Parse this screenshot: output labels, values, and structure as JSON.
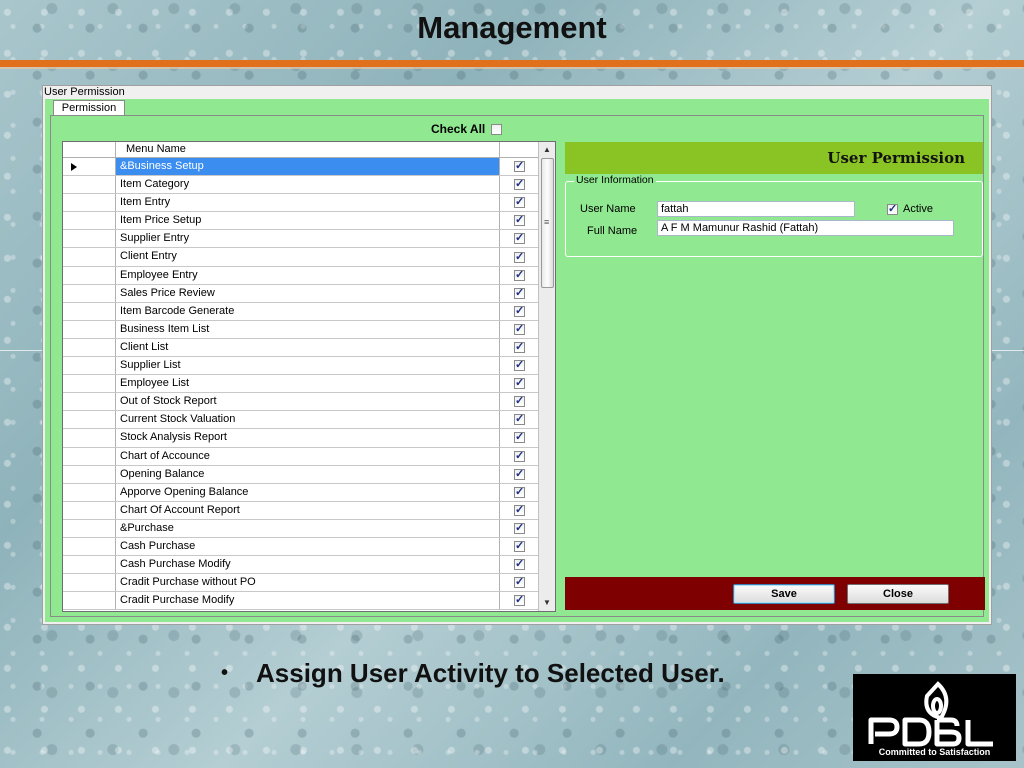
{
  "slide": {
    "title": "Management",
    "bullet": "Assign User Activity to Selected User."
  },
  "window": {
    "title": "User Permission",
    "tab_label": "Permission",
    "check_all_label": "Check All",
    "check_all_checked": false
  },
  "grid": {
    "column_header": "Menu Name",
    "rows": [
      {
        "name": "&Business Setup",
        "checked": true,
        "selected": true
      },
      {
        "name": "Item Category",
        "checked": true
      },
      {
        "name": "Item Entry",
        "checked": true
      },
      {
        "name": "Item Price Setup",
        "checked": true
      },
      {
        "name": "Supplier Entry",
        "checked": true
      },
      {
        "name": "Client Entry",
        "checked": true
      },
      {
        "name": "Employee Entry",
        "checked": true
      },
      {
        "name": "Sales Price Review",
        "checked": true
      },
      {
        "name": "Item Barcode Generate",
        "checked": true
      },
      {
        "name": "Business Item List",
        "checked": true
      },
      {
        "name": "Client List",
        "checked": true
      },
      {
        "name": "Supplier List",
        "checked": true
      },
      {
        "name": "Employee List",
        "checked": true
      },
      {
        "name": "Out of Stock Report",
        "checked": true
      },
      {
        "name": "Current Stock Valuation",
        "checked": true
      },
      {
        "name": "Stock Analysis Report",
        "checked": true
      },
      {
        "name": "Chart of Accounce",
        "checked": true
      },
      {
        "name": "Opening Balance",
        "checked": true
      },
      {
        "name": "Apporve Opening Balance",
        "checked": true
      },
      {
        "name": "Chart Of Account Report",
        "checked": true
      },
      {
        "name": "&Purchase",
        "checked": true
      },
      {
        "name": "Cash Purchase",
        "checked": true
      },
      {
        "name": "Cash Purchase Modify",
        "checked": true
      },
      {
        "name": "Cradit Purchase without PO",
        "checked": true
      },
      {
        "name": "Cradit Purchase Modify",
        "checked": true
      }
    ]
  },
  "panel": {
    "banner_title": "User Permission",
    "group_title": "User Information",
    "user_name_label": "User Name",
    "user_name_value": "fattah",
    "full_name_label": "Full Name",
    "full_name_value": "A F M Mamunur Rashid (Fattah)",
    "active_label": "Active",
    "active_checked": true
  },
  "buttons": {
    "save": "Save",
    "close": "Close"
  },
  "logo": {
    "brand": "PDBL",
    "tagline": "Committed to Satisfaction"
  },
  "colors": {
    "accent_orange": "#e0701c",
    "form_green": "#90e890",
    "banner_green": "#8ac424",
    "footer_maroon": "#7f0000",
    "selection_blue": "#3b8ef0"
  }
}
